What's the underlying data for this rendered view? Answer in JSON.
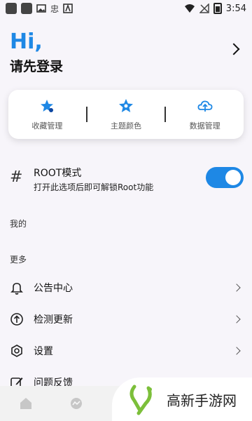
{
  "status_bar": {
    "time": "3:54",
    "glyph": "忠"
  },
  "header": {
    "hi": "Hi,",
    "login_prompt": "请先登录"
  },
  "card": {
    "items": [
      {
        "label": "收藏管理",
        "icon": "star-pin-icon"
      },
      {
        "label": "主题颜色",
        "icon": "star-badge-icon"
      },
      {
        "label": "数据管理",
        "icon": "cloud-icon"
      }
    ]
  },
  "root": {
    "title": "ROOT模式",
    "subtitle": "打开此选项后即可解锁Root功能",
    "enabled": true
  },
  "sections": {
    "mine": "我的",
    "more": "更多"
  },
  "menu": [
    {
      "label": "公告中心",
      "icon": "bell-icon"
    },
    {
      "label": "检测更新",
      "icon": "arrow-up-circle-icon"
    },
    {
      "label": "设置",
      "icon": "hexagon-gear-icon"
    },
    {
      "label": "问题反馈",
      "icon": "edit-icon"
    }
  ],
  "watermark": {
    "text": "高新手游网"
  },
  "colors": {
    "accent": "#1e88e5",
    "watermark_green": "#7cbf3a"
  }
}
